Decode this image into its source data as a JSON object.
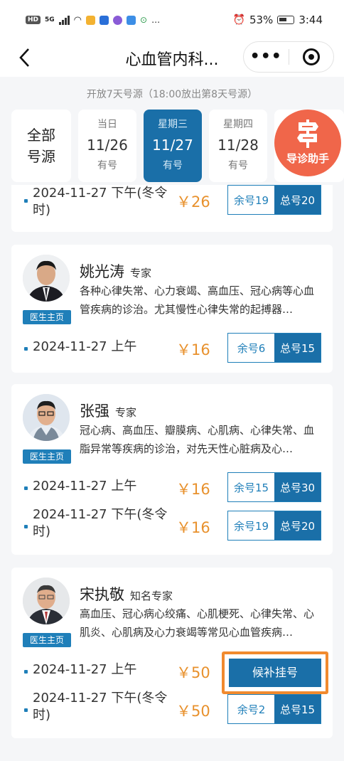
{
  "status_bar": {
    "hd": "HD",
    "net": "5G",
    "battery": "53%",
    "time": "3:44"
  },
  "nav": {
    "title": "心血管内科..."
  },
  "header": {
    "open_note": "开放7天号源（18:00放出第8天号源）",
    "all_label_1": "全部",
    "all_label_2": "号源",
    "dates": [
      {
        "weekday": "当日",
        "date": "11/26",
        "status": "有号",
        "active": false
      },
      {
        "weekday": "星期三",
        "date": "11/27",
        "status": "有号",
        "active": true
      },
      {
        "weekday": "星期四",
        "date": "11/28",
        "status": "有号",
        "active": false
      }
    ],
    "guide_label": "导诊助手"
  },
  "doctor_home_label": "医生主页",
  "partial_card": {
    "slots": [
      {
        "time": "2024-11-27  下午(冬令时)",
        "price": "￥26",
        "remaining": "余号19",
        "total": "总号20"
      }
    ]
  },
  "doctors": [
    {
      "name": "姚光涛",
      "title": "专家",
      "desc": "各种心律失常、心力衰竭、高血压、冠心病等心血管疾病的诊治。尤其慢性心律失常的起搏器…",
      "slots": [
        {
          "time": "2024-11-27  上午",
          "price": "￥16",
          "remaining": "余号6",
          "total": "总号15"
        }
      ]
    },
    {
      "name": "张强",
      "title": "专家",
      "desc": "冠心病、高血压、瓣膜病、心肌病、心律失常、血脂异常等疾病的诊治，对先天性心脏病及心…",
      "slots": [
        {
          "time": "2024-11-27  上午",
          "price": "￥16",
          "remaining": "余号15",
          "total": "总号30"
        },
        {
          "time": "2024-11-27  下午(冬令时)",
          "price": "￥16",
          "remaining": "余号19",
          "total": "总号20"
        }
      ]
    },
    {
      "name": "宋执敬",
      "title": "知名专家",
      "desc": "高血压、冠心病心绞痛、心肌梗死、心律失常、心肌炎、心肌病及心力衰竭等常见心血管疾病…",
      "slots": [
        {
          "time": "2024-11-27  上午",
          "price": "￥50",
          "waitlist": "候补挂号"
        },
        {
          "time": "2024-11-27  下午(冬令时)",
          "price": "￥50",
          "remaining": "余号2",
          "total": "总号15"
        }
      ]
    }
  ]
}
